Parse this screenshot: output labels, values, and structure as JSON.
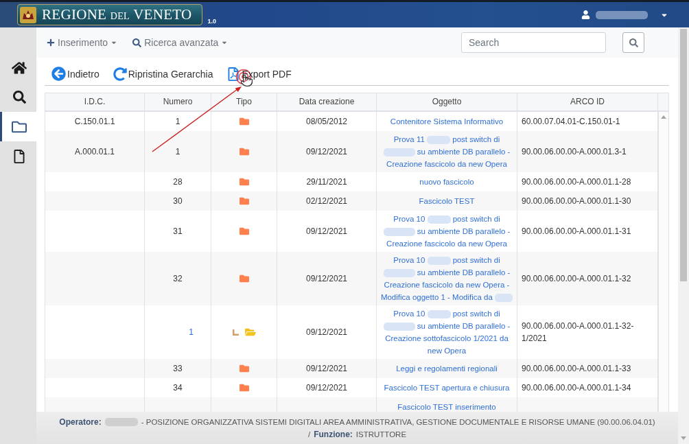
{
  "header": {
    "logo": {
      "title": [
        "REGIONE",
        "DEL",
        "VENETO"
      ],
      "version": "1.0"
    }
  },
  "navbar": {
    "menus": [
      {
        "kind": "add",
        "label": "Inserimento"
      },
      {
        "kind": "search",
        "label": "Ricerca avanzata"
      }
    ],
    "search": {
      "placeholder": "Search"
    }
  },
  "sidebar": {
    "items": [
      {
        "kind": "home",
        "selected": false
      },
      {
        "kind": "search",
        "selected": false
      },
      {
        "kind": "folder",
        "selected": true
      },
      {
        "kind": "document",
        "selected": false
      }
    ]
  },
  "toolbar": {
    "buttons": [
      {
        "kind": "back",
        "label": "Indietro"
      },
      {
        "kind": "reset",
        "label": "Ripristina Gerarchia"
      },
      {
        "kind": "pdf",
        "label": "Export PDF"
      }
    ]
  },
  "table": {
    "columns": [
      "I.D.C.",
      "Numero",
      "Tipo",
      "Data creazione",
      "Oggetto",
      "ARCO ID"
    ],
    "rows": [
      {
        "idc": "C.150.01.1",
        "numero": "1",
        "data": "08/05/2012",
        "oggetto": [
          {
            "kind": "text",
            "text": "Contenitore Sistema Informativo"
          }
        ],
        "arco_id": "60.00.07.04.01-C.150.01-1"
      },
      {
        "idc": "A.000.01.1",
        "numero": "1",
        "data": "09/12/2021",
        "oggetto": [
          {
            "kind": "text",
            "text": "Prova 11"
          },
          {
            "kind": "redacted"
          },
          {
            "kind": "text",
            "text": "post switch di"
          },
          {
            "kind": "redacted"
          },
          {
            "kind": "text",
            "text": "su ambiente DB parallelo - Creazione fascicolo da new Opera"
          }
        ],
        "arco_id": "90.00.06.00.00-A.000.01.3-1"
      },
      {
        "numero": "28",
        "data": "29/11/2021",
        "oggetto": [
          {
            "kind": "text",
            "text": "nuovo fascicolo"
          }
        ],
        "arco_id": "90.00.06.00.00-A.000.01.1-28"
      },
      {
        "numero": "30",
        "data": "02/12/2021",
        "oggetto": [
          {
            "kind": "text",
            "text": "Fascicolo TEST"
          }
        ],
        "arco_id": "90.00.06.00.00-A.000.01.1-30"
      },
      {
        "numero": "31",
        "data": "09/12/2021",
        "oggetto": [
          {
            "kind": "text",
            "text": "Prova 10"
          },
          {
            "kind": "redacted"
          },
          {
            "kind": "text",
            "text": "post switch di"
          },
          {
            "kind": "redacted"
          },
          {
            "kind": "text",
            "text": "su ambiente DB parallelo - Creazione fascicolo da new Opera"
          }
        ],
        "arco_id": "90.00.06.00.00-A.000.01.1-31"
      },
      {
        "numero": "32",
        "data": "09/12/2021",
        "oggetto": [
          {
            "kind": "text",
            "text": "Prova 10"
          },
          {
            "kind": "redacted"
          },
          {
            "kind": "text",
            "text": "post switch di"
          },
          {
            "kind": "redacted"
          },
          {
            "kind": "text",
            "text": "su ambiente DB parallelo - Creazione fascicolo da new Opera - Modifica oggetto 1 - Modifica da"
          },
          {
            "kind": "redacted"
          }
        ],
        "arco_id": "90.00.06.00.00-A.000.01.1-32",
        "children": [
          {
            "numero": "1",
            "data": "09/12/2021",
            "oggetto": [
              {
                "kind": "text",
                "text": "Prova 10"
              },
              {
                "kind": "redacted"
              },
              {
                "kind": "text",
                "text": "post switch di"
              },
              {
                "kind": "redacted"
              },
              {
                "kind": "text",
                "text": "su ambiente DB parallelo - Creazione sottofascicolo 1/2021 da new Opera"
              }
            ],
            "arco_id": "90.00.06.00.00-A.000.01.1-32-1/2021"
          }
        ]
      },
      {
        "numero": "33",
        "data": "09/12/2021",
        "oggetto": [
          {
            "kind": "text",
            "text": "Leggi e regolamenti regionali"
          }
        ],
        "arco_id": "90.00.06.00.00-A.000.01.1-33"
      },
      {
        "numero": "34",
        "data": "09/12/2021",
        "oggetto": [
          {
            "kind": "text",
            "text": "Fascicolo TEST apertura e chiusura"
          }
        ],
        "arco_id": "90.00.06.00.00-A.000.01.1-34"
      },
      {
        "oggetto": [
          {
            "kind": "text",
            "text": "Fascicolo TEST inserimento"
          }
        ]
      }
    ]
  },
  "footer": {
    "lines": [
      [
        {
          "kind": "label",
          "text": "Operatore:"
        },
        {
          "kind": "redacted"
        },
        {
          "kind": "text",
          "text": "- POSIZIONE ORGANIZZATIVA SISTEMI DIGITALI AREA AMMINISTRATIVA, GESTIONE DOCUMENTALE E RISORSE UMANE (90.00.06.04.01)"
        }
      ],
      [
        {
          "kind": "text",
          "text": "/"
        },
        {
          "kind": "label",
          "text": "Funzione:"
        },
        {
          "kind": "text",
          "text": "ISTRUTTORE"
        }
      ]
    ]
  }
}
